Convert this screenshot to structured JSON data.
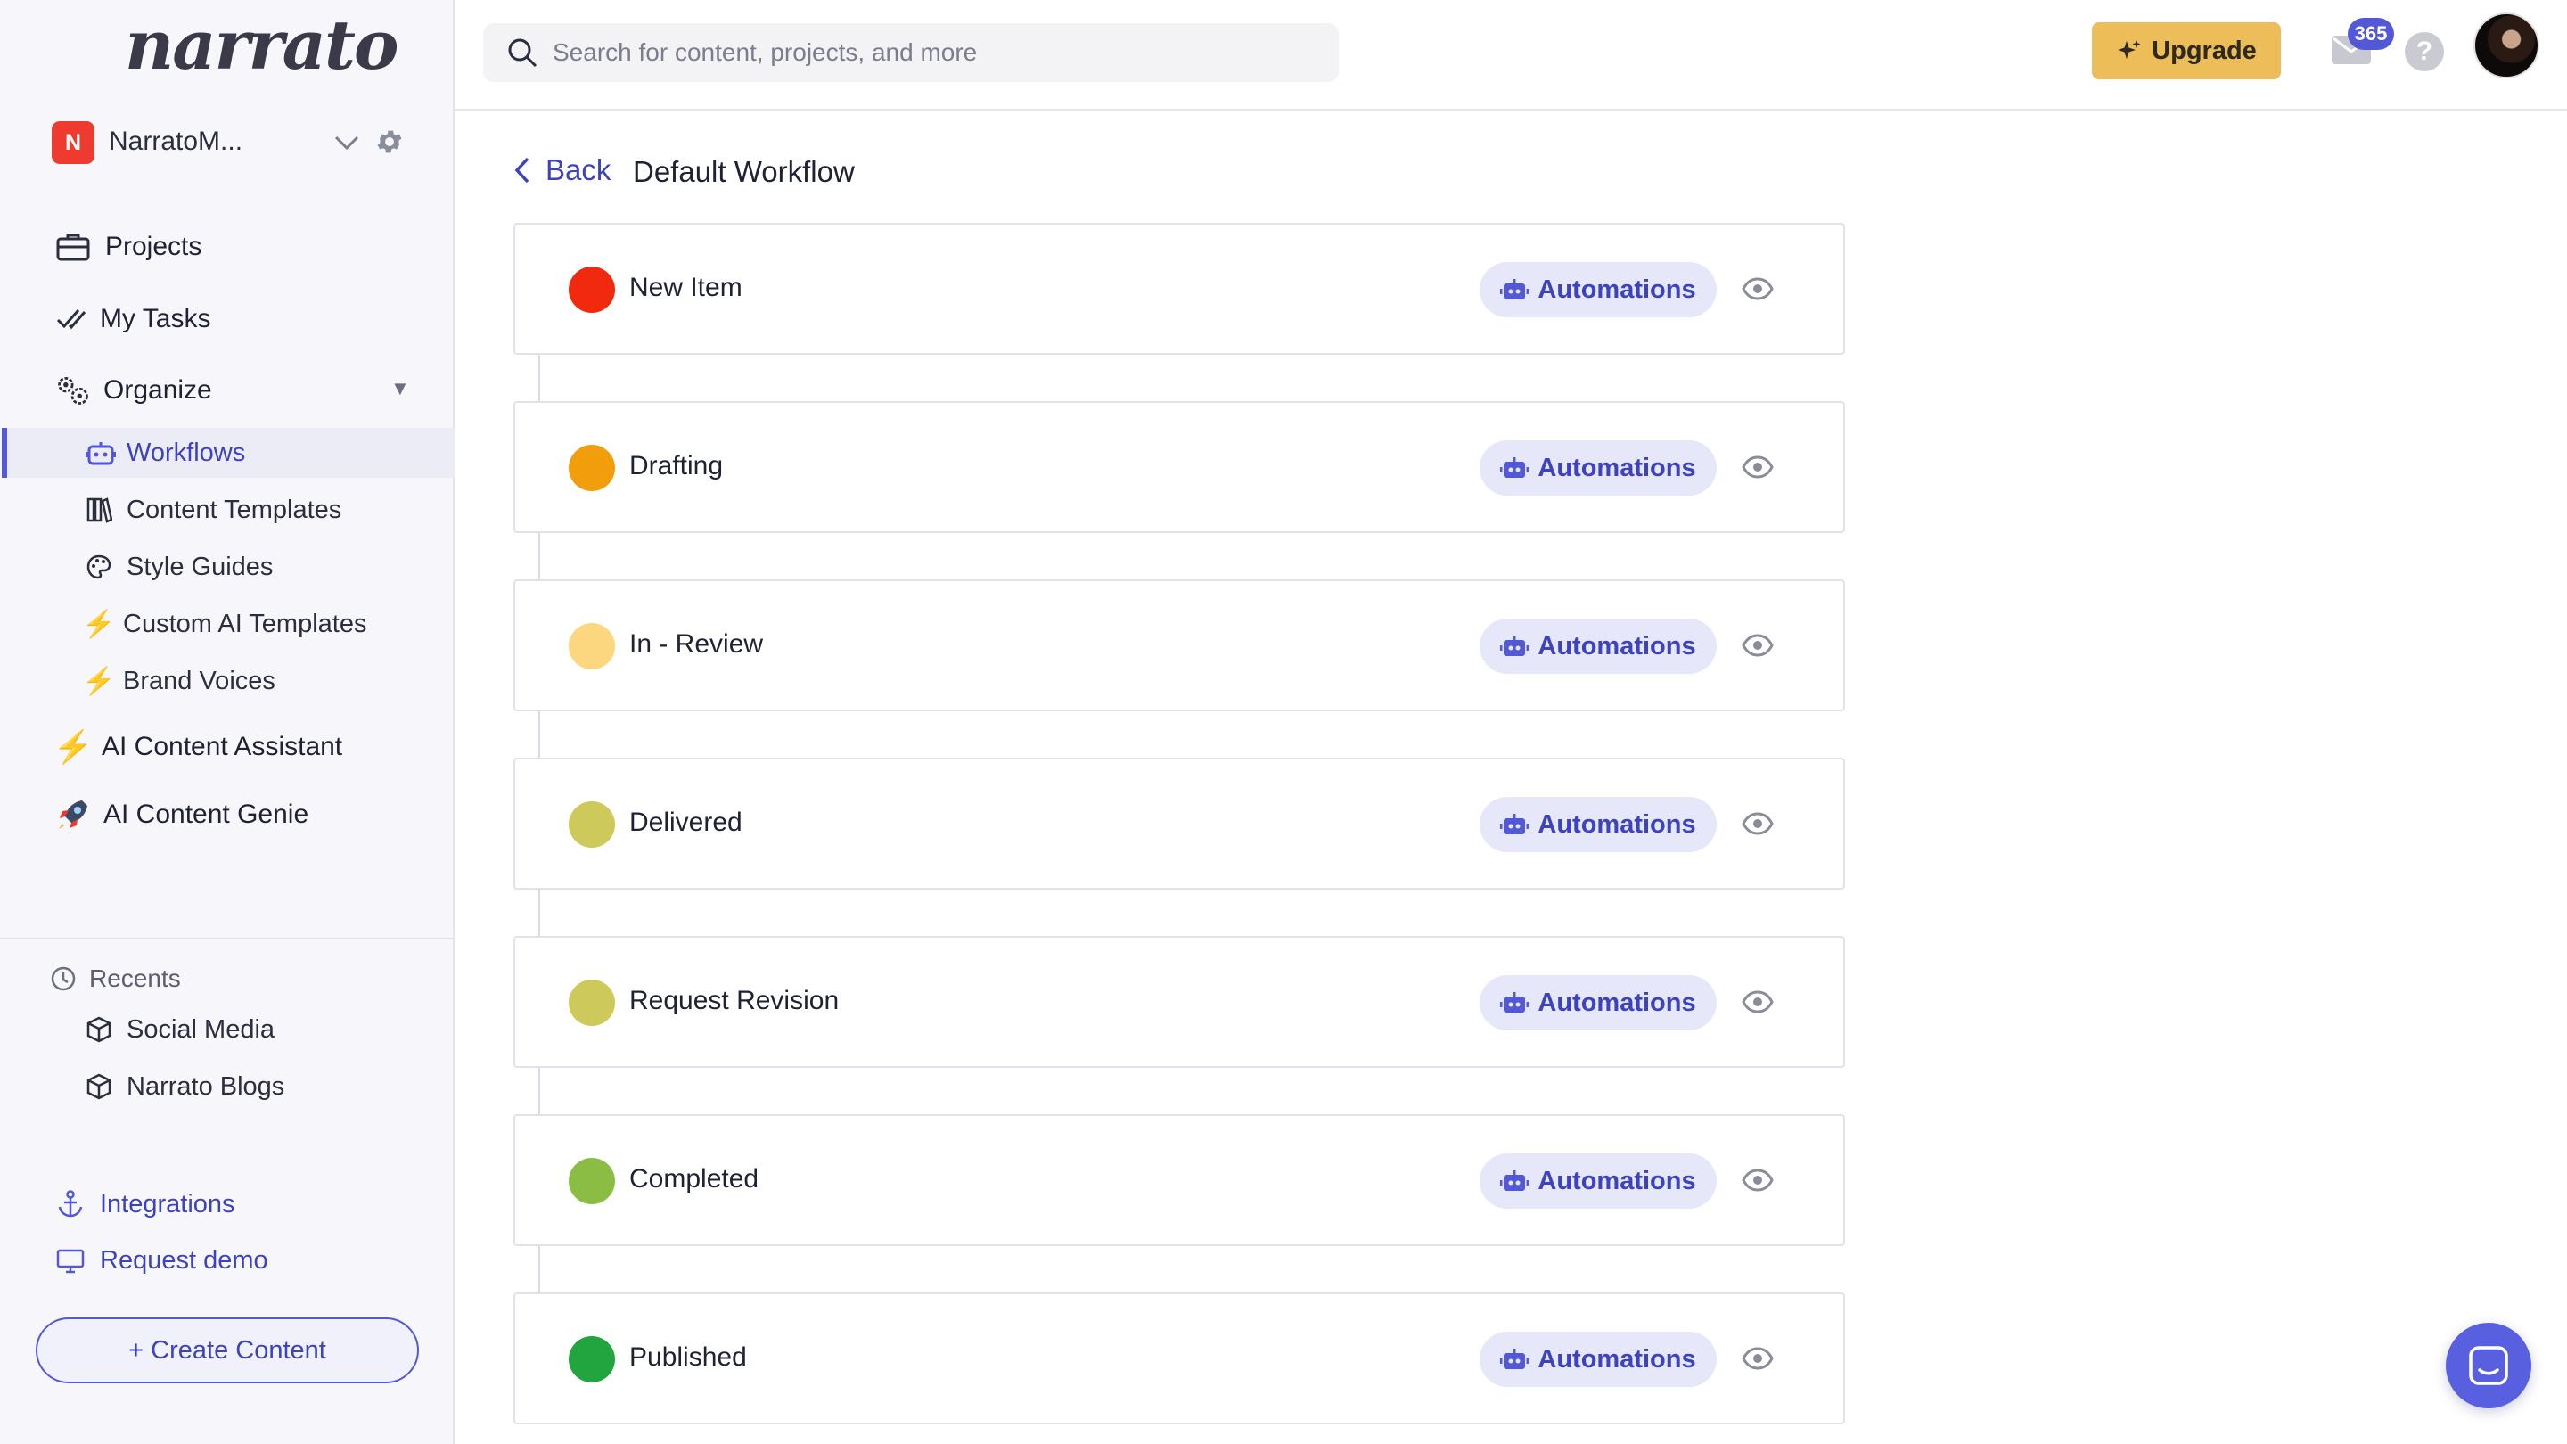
{
  "app": {
    "logo_text": "narrato"
  },
  "workspace": {
    "initial": "N",
    "name": "NarratoM..."
  },
  "nav": {
    "projects": "Projects",
    "my_tasks": "My Tasks",
    "organize": "Organize",
    "organize_items": [
      {
        "label": "Workflows",
        "icon": "robot-icon",
        "active": true
      },
      {
        "label": "Content Templates",
        "icon": "books-icon"
      },
      {
        "label": "Style Guides",
        "icon": "palette-icon"
      },
      {
        "label": "Custom AI Templates",
        "icon": "bolt-icon"
      },
      {
        "label": "Brand Voices",
        "icon": "bolt-icon"
      }
    ],
    "ai_content_assistant": "AI Content Assistant",
    "ai_content_genie": "AI Content Genie"
  },
  "recents": {
    "title": "Recents",
    "items": [
      {
        "label": "Social Media",
        "icon": "cube-icon"
      },
      {
        "label": "Narrato Blogs",
        "icon": "cube-icon"
      }
    ]
  },
  "links": {
    "integrations": "Integrations",
    "request_demo": "Request demo"
  },
  "create_content": {
    "label": "+ Create Content"
  },
  "search": {
    "placeholder": "Search for content, projects, and more"
  },
  "topbar": {
    "upgrade_label": "Upgrade",
    "notification_count": "365",
    "help_label": "?"
  },
  "page": {
    "back_label": "Back",
    "title": "Default Workflow"
  },
  "workflow": {
    "automations_label": "Automations",
    "stages": [
      {
        "name": "New Item",
        "color": "#f0290f"
      },
      {
        "name": "Drafting",
        "color": "#f29e0c"
      },
      {
        "name": "In - Review",
        "color": "#fdd680"
      },
      {
        "name": "Delivered",
        "color": "#cdc95a"
      },
      {
        "name": "Request Revision",
        "color": "#cdc95a"
      },
      {
        "name": "Completed",
        "color": "#8bbd45"
      },
      {
        "name": "Published",
        "color": "#22a43e"
      }
    ]
  },
  "colors": {
    "accent": "#5258d6",
    "upgrade": "#ecbd58"
  }
}
